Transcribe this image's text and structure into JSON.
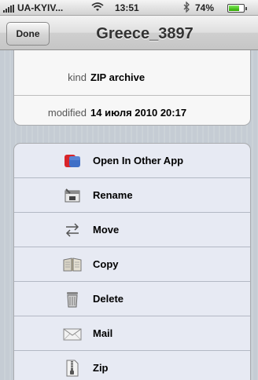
{
  "status_bar": {
    "carrier": "UA-KYIV...",
    "time": "13:51",
    "battery_percent": "74%",
    "battery_level": 0.74
  },
  "nav": {
    "done_label": "Done",
    "title": "Greece_3897"
  },
  "info": {
    "kind_key": "kind",
    "kind_value": "ZIP archive",
    "modified_key": "modified",
    "modified_value": "14 июля 2010 20:17"
  },
  "actions": [
    {
      "label": "Open In Other App",
      "icon": "open-in-app-icon"
    },
    {
      "label": "Rename",
      "icon": "rename-icon"
    },
    {
      "label": "Move",
      "icon": "move-icon"
    },
    {
      "label": "Copy",
      "icon": "copy-icon"
    },
    {
      "label": "Delete",
      "icon": "trash-icon"
    },
    {
      "label": "Mail",
      "icon": "mail-icon"
    },
    {
      "label": "Zip",
      "icon": "zip-icon"
    }
  ]
}
